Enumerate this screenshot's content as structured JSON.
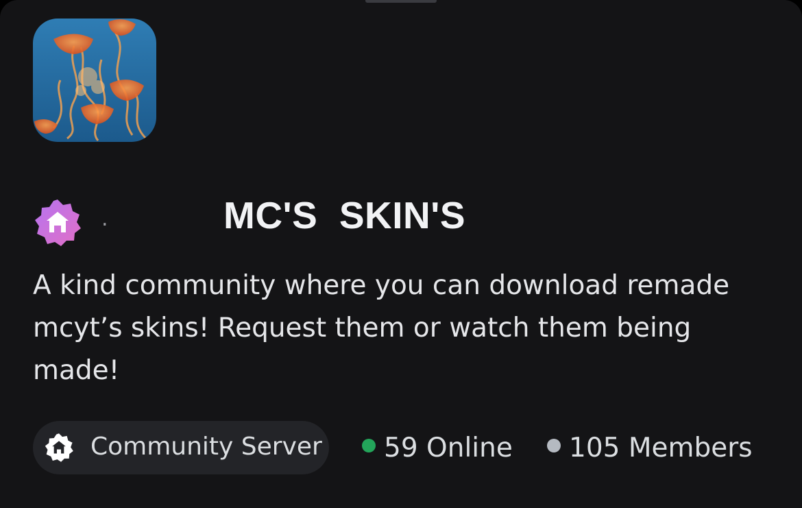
{
  "server": {
    "name": "MC'S  SKIN'S",
    "name_prefix": ".",
    "description": "A kind community where you can download remade mcyt’s skins! Request them or watch them being made!",
    "icon": "jellyfish-server-icon",
    "badge_icon": "home-badge-icon"
  },
  "tags": {
    "community_label": "Community Server",
    "community_icon": "home-badge-icon"
  },
  "stats": {
    "online": "59 Online",
    "members": "105 Members"
  },
  "colors": {
    "background": "#141416",
    "online_dot": "#23a55a",
    "members_dot": "#b5bac1",
    "badge_gradient_start": "#b574f0",
    "badge_gradient_end": "#e26fc6",
    "pill_background": "#232428"
  }
}
